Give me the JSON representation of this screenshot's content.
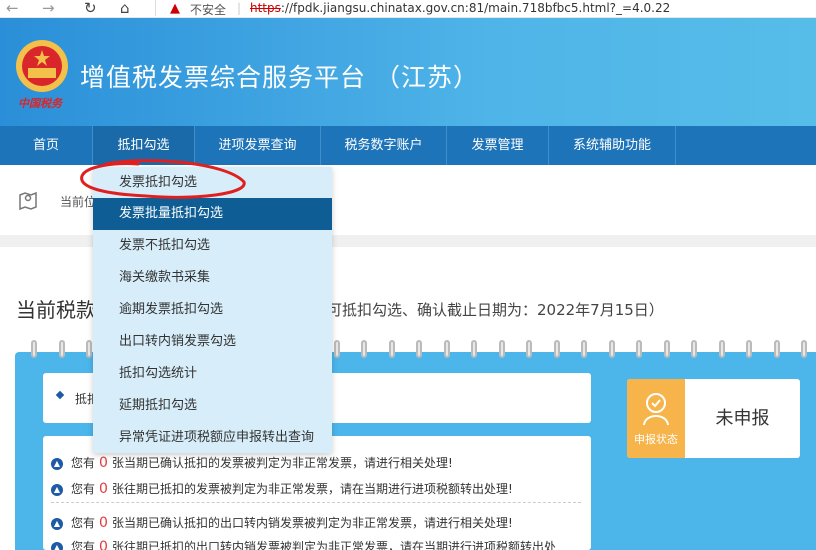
{
  "browser": {
    "security_warning": "不安全",
    "url_protocol": "https",
    "url_rest": "://fpdk.jiangsu.chinatax.gov.cn:81/main.718bfbc5.html?_=4.0.22"
  },
  "header": {
    "logo_text": "中国税务",
    "title": "增值税发票综合服务平台 （江苏）"
  },
  "menu": {
    "items": [
      "首页",
      "抵扣勾选",
      "进项发票查询",
      "税务数字账户",
      "发票管理",
      "系统辅助功能"
    ]
  },
  "breadcrumb": {
    "text": "当前位"
  },
  "period": {
    "prefix": "当前税款",
    "suffix": "期可抵扣勾选、确认截止日期为：2022年7月15日）"
  },
  "dropdown": {
    "items": [
      "发票抵扣勾选",
      "发票批量抵扣勾选",
      "发票不抵扣勾选",
      "海关缴款书采集",
      "逾期发票抵扣勾选",
      "出口转内销发票勾选",
      "抵扣勾选统计",
      "延期抵扣勾选",
      "异常凭证进项税额应申报转出查询"
    ],
    "highlighted_index": 1
  },
  "card_top": {
    "label": "抵扣"
  },
  "notices": [
    {
      "prefix": "您有",
      "count": "0",
      "text": "张当期已确认抵扣的发票被判定为非正常发票，请进行相关处理!"
    },
    {
      "prefix": "您有",
      "count": "0",
      "text": "张往期已抵扣的发票被判定为非正常发票，请在当期进行进项税额转出处理!"
    },
    {
      "prefix": "您有",
      "count": "0",
      "text": "张当期已确认抵扣的出口转内销发票被判定为非正常发票，请进行相关处理!"
    },
    {
      "prefix": "您有",
      "count": "0",
      "text": "张往期已抵扣的出口转内销发票被判定为非正常发票，请在当期进行进项税额转出处"
    }
  ],
  "status": {
    "label": "申报状态",
    "value": "未申报"
  },
  "colors": {
    "header_start": "#2a8fd8",
    "menu_bg": "#1e74b8",
    "dropdown_bg": "#d7eefa",
    "dropdown_highlight": "#0e5e95",
    "panel_bg": "#4cb6ea",
    "status_orange": "#f6b44b",
    "annotation_red": "#e02020",
    "count_red": "#e23b3b"
  }
}
